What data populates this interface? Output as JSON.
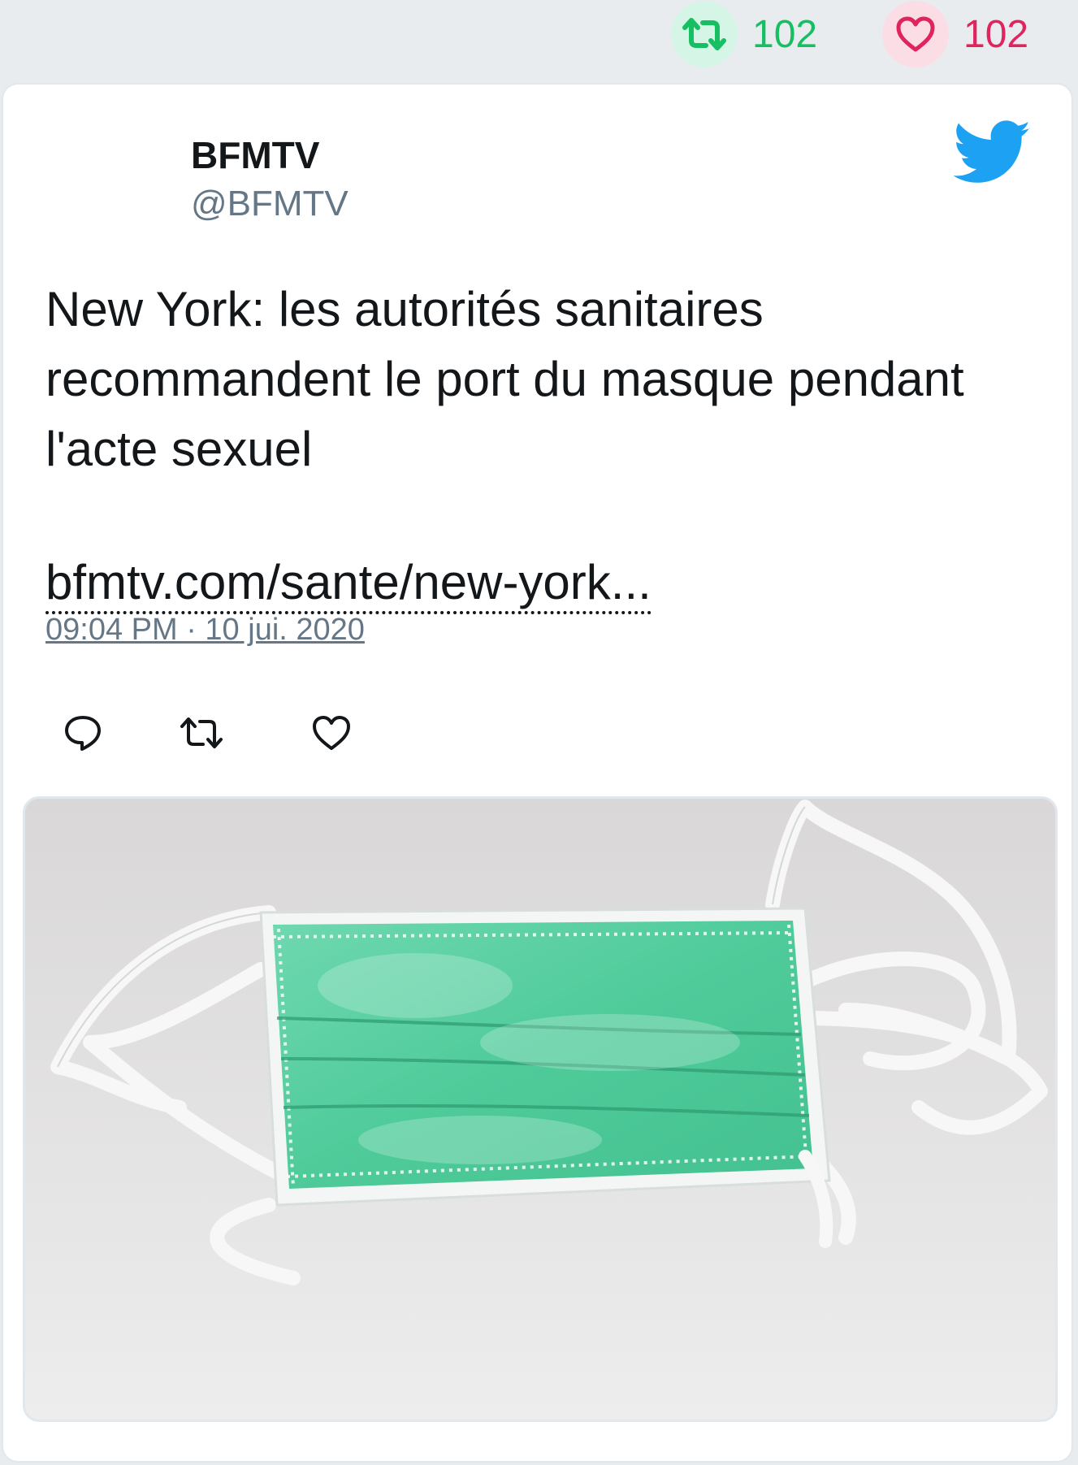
{
  "stats": {
    "retweet_icon": "retweet-icon",
    "retweet_count": "102",
    "like_icon": "heart-icon",
    "like_count": "102",
    "retweet_color": "#17bf63",
    "like_color": "#e0245e"
  },
  "tweet": {
    "author_name": "BFMTV",
    "author_handle": "@BFMTV",
    "brand_icon": "twitter-bird-icon",
    "brand_color": "#1da1f2",
    "text": "New York: les autorités sanitaires recommandent le port du masque pendant l'acte sexuel",
    "link_text": "bfmtv.com/sante/new-york...",
    "timestamp": "09:04 PM · 10 jui. 2020",
    "actions": [
      "reply-icon",
      "retweet-icon",
      "like-icon"
    ],
    "media_subject": "green surgical face mask on white surface"
  }
}
